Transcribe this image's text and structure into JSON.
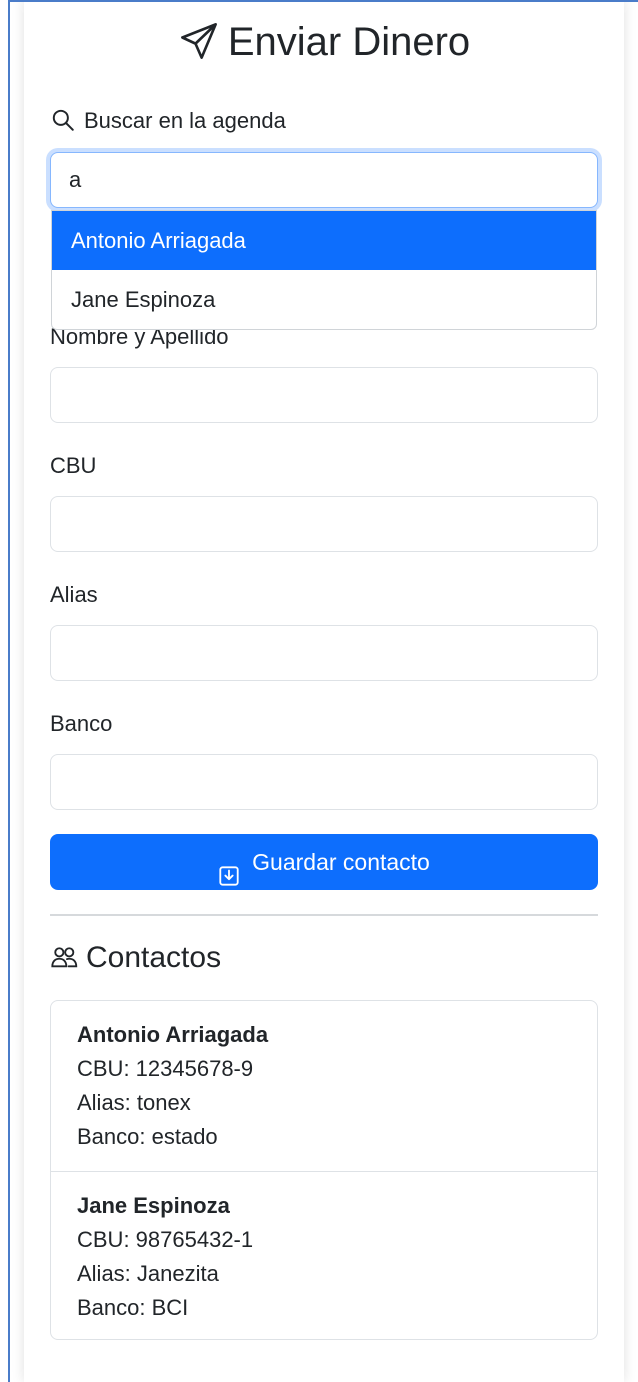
{
  "header": {
    "title": "Enviar Dinero",
    "icon": "send-icon"
  },
  "search": {
    "label": "Buscar en la agenda",
    "icon": "search-icon",
    "value": "a",
    "suggestions": [
      {
        "label": "Antonio Arriagada",
        "active": true
      },
      {
        "label": "Jane Espinoza",
        "active": false
      }
    ]
  },
  "form": {
    "name_label": "Nombre y Apellido",
    "name_value": "",
    "cbu_label": "CBU",
    "cbu_value": "",
    "alias_label": "Alias",
    "alias_value": "",
    "bank_label": "Banco",
    "bank_value": "",
    "save_label": "Guardar contacto",
    "save_icon": "save-icon"
  },
  "contacts": {
    "title": "Contactos",
    "icon": "people-icon",
    "items": [
      {
        "name": "Antonio Arriagada",
        "cbu": "CBU: 12345678-9",
        "alias": "Alias: tonex",
        "bank": "Banco: estado"
      },
      {
        "name": "Jane Espinoza",
        "cbu": "CBU: 98765432-1",
        "alias": "Alias: Janezita",
        "bank": "Banco: BCI"
      }
    ]
  },
  "colors": {
    "primary": "#0d6efd",
    "focus_ring": "#86b7fe",
    "border": "#dee2e6",
    "text": "#212529"
  }
}
